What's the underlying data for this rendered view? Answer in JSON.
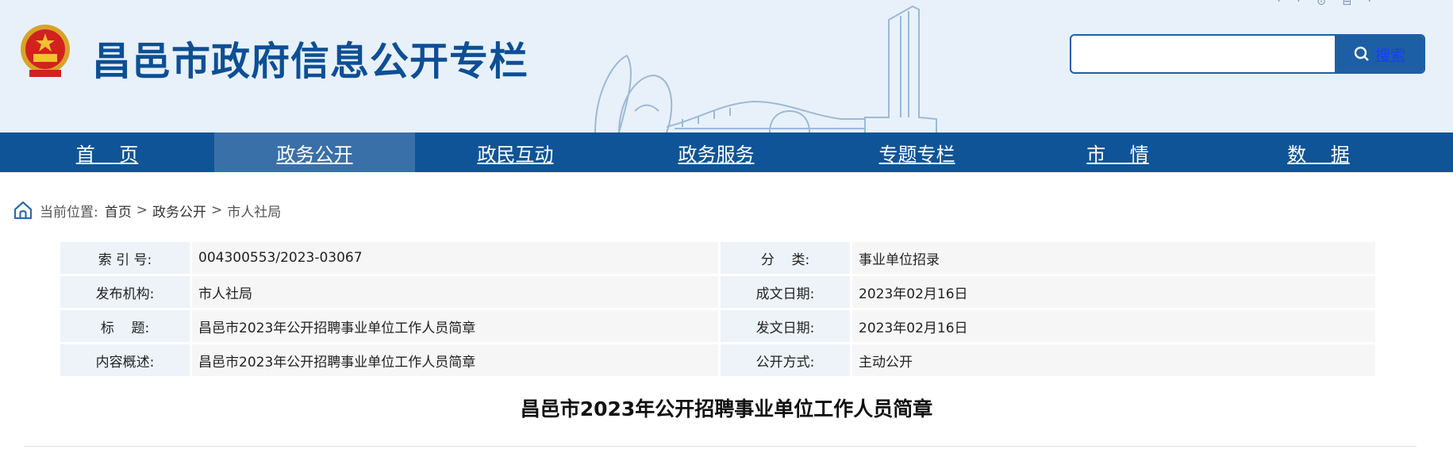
{
  "header": {
    "site_title": "昌邑市政府信息公开专栏",
    "top_util": "· ·   ⊙  ⊟  ·",
    "search": {
      "placeholder": "",
      "value": "",
      "button_label": "搜索"
    }
  },
  "nav": {
    "items": [
      {
        "label": "首    页",
        "active": false
      },
      {
        "label": "政务公开",
        "active": true
      },
      {
        "label": "政民互动",
        "active": false
      },
      {
        "label": "政务服务",
        "active": false
      },
      {
        "label": "专题专栏",
        "active": false
      },
      {
        "label": "市    情",
        "active": false
      },
      {
        "label": "数    据",
        "active": false
      }
    ]
  },
  "breadcrumb": {
    "prefix": "当前位置:",
    "items": [
      "首页",
      "政务公开",
      "市人社局"
    ],
    "separator": ">"
  },
  "info": {
    "rows": [
      {
        "label1": "索 引 号:",
        "value1": "004300553/2023-03067",
        "label2": "分    类:",
        "value2": "事业单位招录"
      },
      {
        "label1": "发布机构:",
        "value1": "市人社局",
        "label2": "成文日期:",
        "value2": "2023年02月16日"
      },
      {
        "label1": "标    题:",
        "value1": "昌邑市2023年公开招聘事业单位工作人员简章",
        "label2": "发文日期:",
        "value2": "2023年02月16日"
      },
      {
        "label1": "内容概述:",
        "value1": "昌邑市2023年公开招聘事业单位工作人员简章",
        "label2": "公开方式:",
        "value2": "主动公开"
      }
    ]
  },
  "article": {
    "title": "昌邑市2023年公开招聘事业单位工作人员简章"
  },
  "colors": {
    "brand_blue": "#0f5497",
    "header_bg": "#e8f1fa",
    "nav_active": "#3a70a8",
    "title_blue": "#0d4f95"
  }
}
